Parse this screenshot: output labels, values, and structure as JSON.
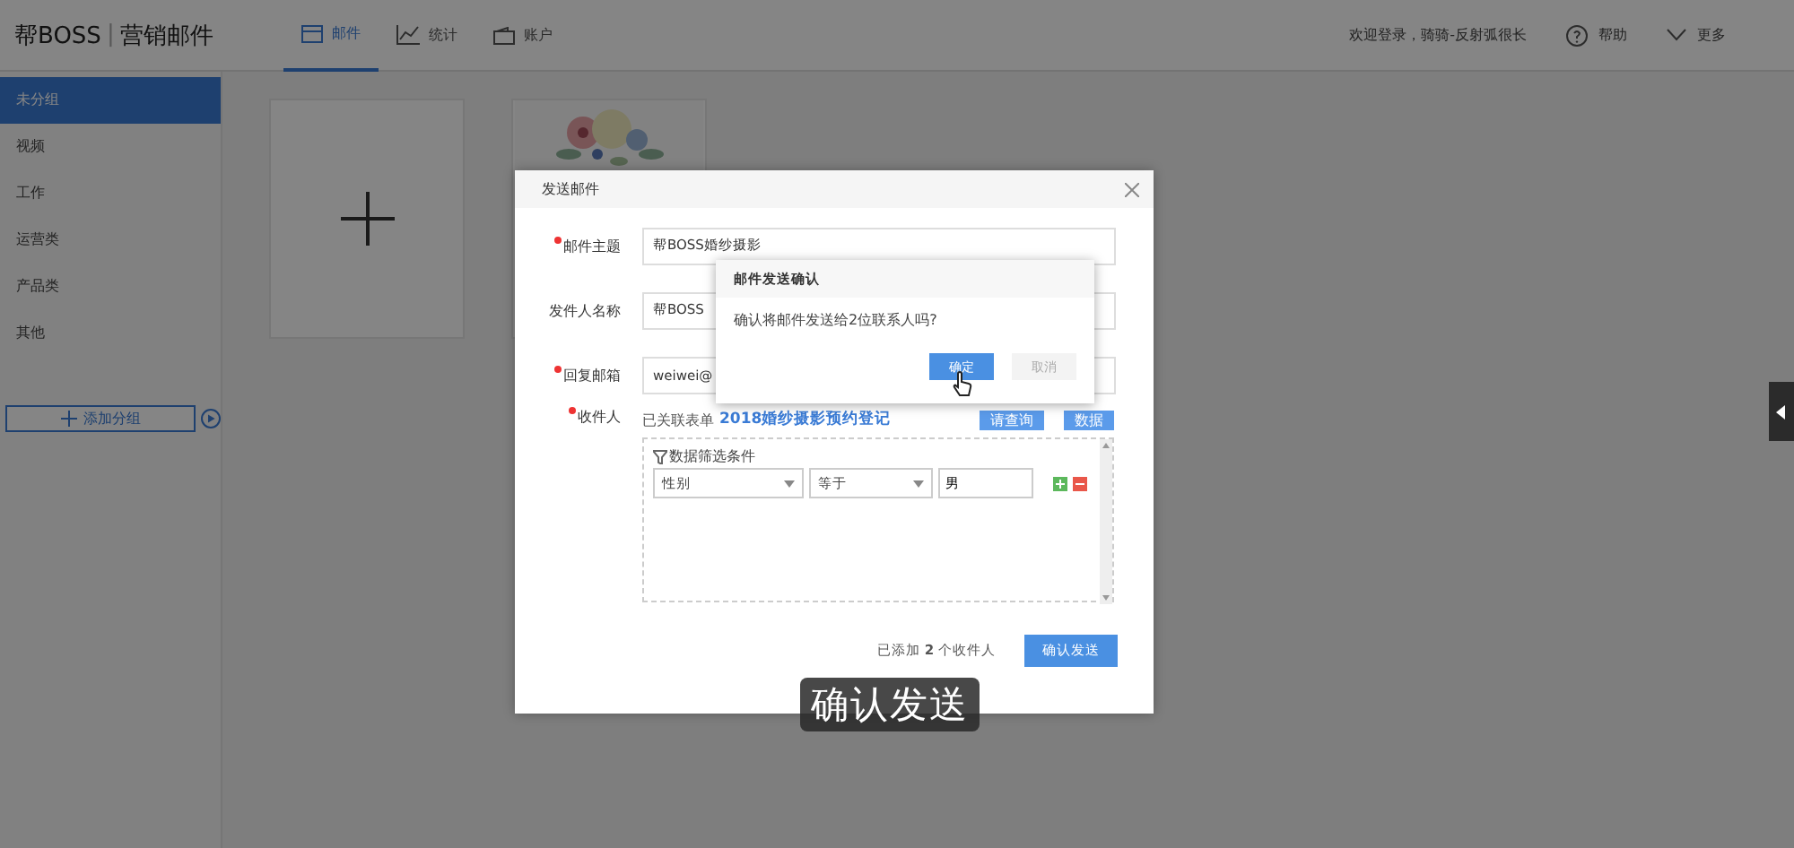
{
  "header": {
    "logo": "帮BOSS",
    "product": "营销邮件",
    "separator": "|",
    "nav": [
      {
        "label": "邮件",
        "selected": true
      },
      {
        "label": "统计",
        "selected": false
      },
      {
        "label": "账户",
        "selected": false
      }
    ],
    "welcome": "欢迎登录，骑骑-反射弧很长",
    "help": "帮助",
    "more": "更多"
  },
  "sidebar": {
    "items": [
      {
        "label": "未分组",
        "selected": true
      },
      {
        "label": "视频",
        "selected": false
      },
      {
        "label": "工作",
        "selected": false
      },
      {
        "label": "运营类",
        "selected": false
      },
      {
        "label": "产品类",
        "selected": false
      },
      {
        "label": "其他",
        "selected": false
      }
    ],
    "add_button": "添加分组"
  },
  "templates": [
    {
      "kind": "add"
    },
    {
      "kind": "picture"
    }
  ],
  "dialog": {
    "title": "发送邮件",
    "fields": [
      {
        "label": "邮件主题",
        "required": true,
        "value": "帮BOSS婚纱摄影"
      },
      {
        "label": "发件人名称",
        "required": false,
        "value": "帮BOSS"
      },
      {
        "label": "回复邮箱",
        "required": true,
        "value": "weiwei@"
      }
    ],
    "recipients": {
      "label": "收件人",
      "required": true,
      "linked_prefix": "已关联表单",
      "linked_form": "2018婚纱摄影预约登记",
      "buttons": [
        "请查询",
        "数据"
      ],
      "filter_title": "数据筛选条件",
      "filter": {
        "field": "性别",
        "operator": "等于",
        "value": "男"
      }
    },
    "footer": {
      "count_text": "已添加 **2** 个收件人",
      "button": "确认发送"
    }
  },
  "confirm": {
    "title": "邮件发送确认",
    "message": "确认将邮件发送给2位联系人吗?",
    "ok": "确定",
    "cancel": "取消",
    "cancel_disabled": true
  },
  "caption": "确认发送"
}
